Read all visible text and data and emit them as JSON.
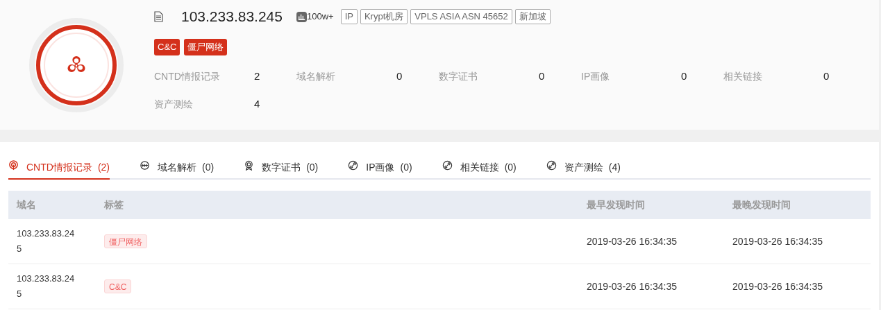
{
  "header": {
    "ip": "103.233.83.245",
    "badges": [
      {
        "kind": "count",
        "text": "100w+"
      },
      {
        "kind": "outline",
        "text": "IP"
      },
      {
        "kind": "outline",
        "text": "Krypt机房"
      },
      {
        "kind": "outline",
        "text": "VPLS ASIA ASN 45652"
      },
      {
        "kind": "outline",
        "text": "新加坡"
      }
    ],
    "threat_tags": [
      "C&C",
      "僵尸网络"
    ],
    "stats": [
      {
        "label": "CNTD情报记录",
        "value": "2"
      },
      {
        "label": "域名解析",
        "value": "0"
      },
      {
        "label": "数字证书",
        "value": "0"
      },
      {
        "label": "IP画像",
        "value": "0"
      },
      {
        "label": "相关链接",
        "value": "0"
      },
      {
        "label": "资产测绘",
        "value": "4"
      }
    ]
  },
  "tabs": [
    {
      "kind": "radar",
      "label": "CNTD情报记录",
      "count": "(2)",
      "selected": true
    },
    {
      "kind": "globe",
      "label": "域名解析",
      "count": "(0)",
      "selected": false
    },
    {
      "kind": "award",
      "label": "数字证书",
      "count": "(0)",
      "selected": false
    },
    {
      "kind": "link",
      "label": "IP画像",
      "count": "(0)",
      "selected": false
    },
    {
      "kind": "link",
      "label": "相关链接",
      "count": "(0)",
      "selected": false
    },
    {
      "kind": "link",
      "label": "资产测绘",
      "count": "(4)",
      "selected": false
    }
  ],
  "table": {
    "columns": [
      "域名",
      "标签",
      "最早发现时间",
      "最晚发现时间"
    ],
    "rows": [
      {
        "domain": "103.233.83.245",
        "tag": "僵尸网络",
        "first_seen": "2019-03-26 16:34:35",
        "last_seen": "2019-03-26 16:34:35"
      },
      {
        "domain": "103.233.83.245",
        "tag": "C&C",
        "first_seen": "2019-03-26 16:34:35",
        "last_seen": "2019-03-26 16:34:35"
      }
    ]
  }
}
